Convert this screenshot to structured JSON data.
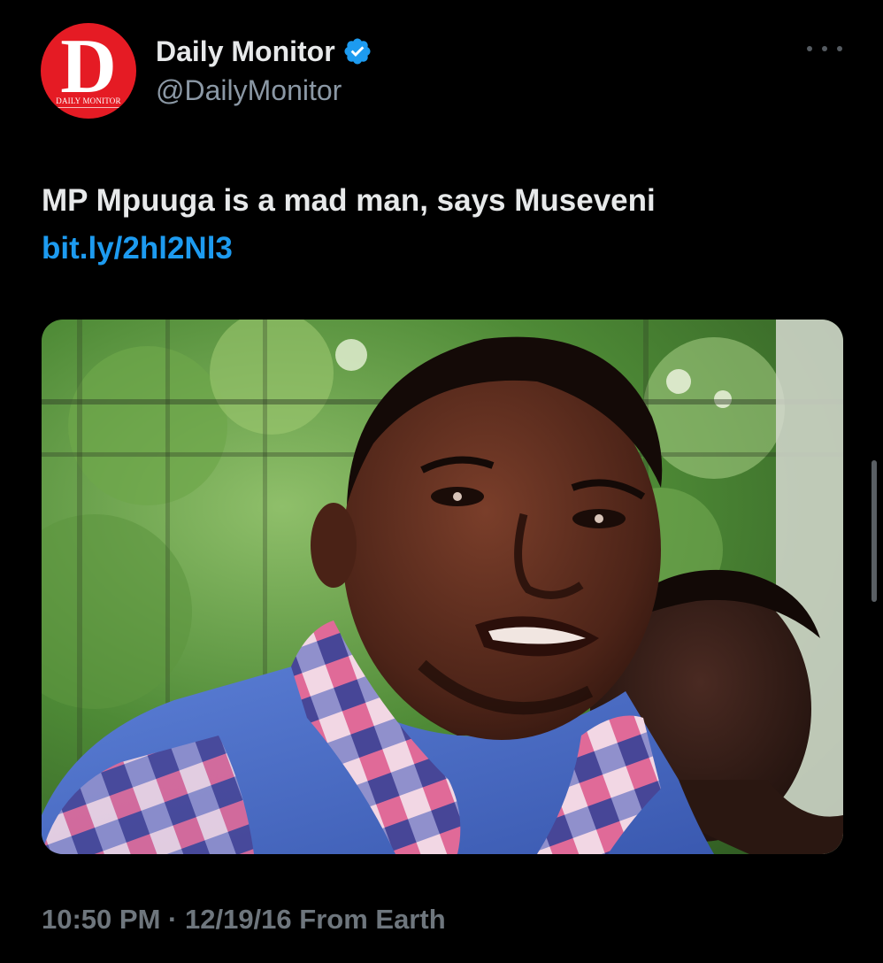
{
  "account": {
    "display_name": "Daily Monitor",
    "handle": "@DailyMonitor",
    "verified": true,
    "avatar": {
      "letter": "D",
      "wordmark": "DAILY MONITOR",
      "background": "#e51b24"
    }
  },
  "tweet": {
    "headline": "MP Mpuuga is a mad man, says Museveni",
    "link_text": "bit.ly/2hl2Nl3",
    "time": "10:50 PM",
    "separator": "·",
    "date": "12/19/16",
    "source": "From Earth"
  },
  "icons": {
    "verified": "verified-badge-icon",
    "more": "more-options-icon"
  },
  "colors": {
    "background": "#000000",
    "text": "#e7e9ea",
    "secondary": "#8b98a5",
    "link": "#1d9bf0",
    "verified": "#1d9bf0"
  }
}
